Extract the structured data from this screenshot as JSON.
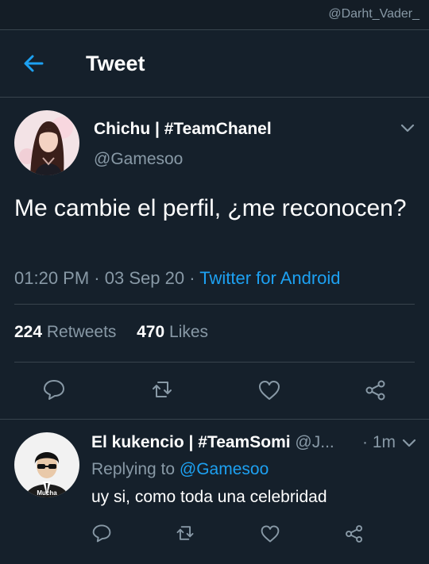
{
  "watermark": "@Darht_Vader_",
  "header": {
    "title": "Tweet"
  },
  "tweet": {
    "author_name": "Chichu | #TeamChanel",
    "author_handle": "@Gamesoo",
    "text": "Me cambie el perfil, ¿me reconocen?",
    "time": "01:20 PM",
    "date": "03 Sep 20",
    "source": "Twitter for Android",
    "retweets_count": "224",
    "retweets_label": "Retweets",
    "likes_count": "470",
    "likes_label": "Likes"
  },
  "reply": {
    "author_name": "El kukencio | #TeamSomi",
    "author_handle": "@J...",
    "time": "1m",
    "replying_prefix": "Replying to",
    "replying_to": "@Gamesoo",
    "text": "uy si, como toda una celebridad",
    "avatar_caption": "Mucha"
  },
  "icons": {
    "back": "arrow-left-icon",
    "caret": "chevron-down-icon",
    "reply": "speech-bubble-icon",
    "retweet": "retweet-icon",
    "like": "heart-icon",
    "share": "share-icon"
  },
  "colors": {
    "background": "#15202b",
    "accent": "#1da1f2",
    "secondary_text": "#8899a6",
    "divider": "#38444d"
  }
}
